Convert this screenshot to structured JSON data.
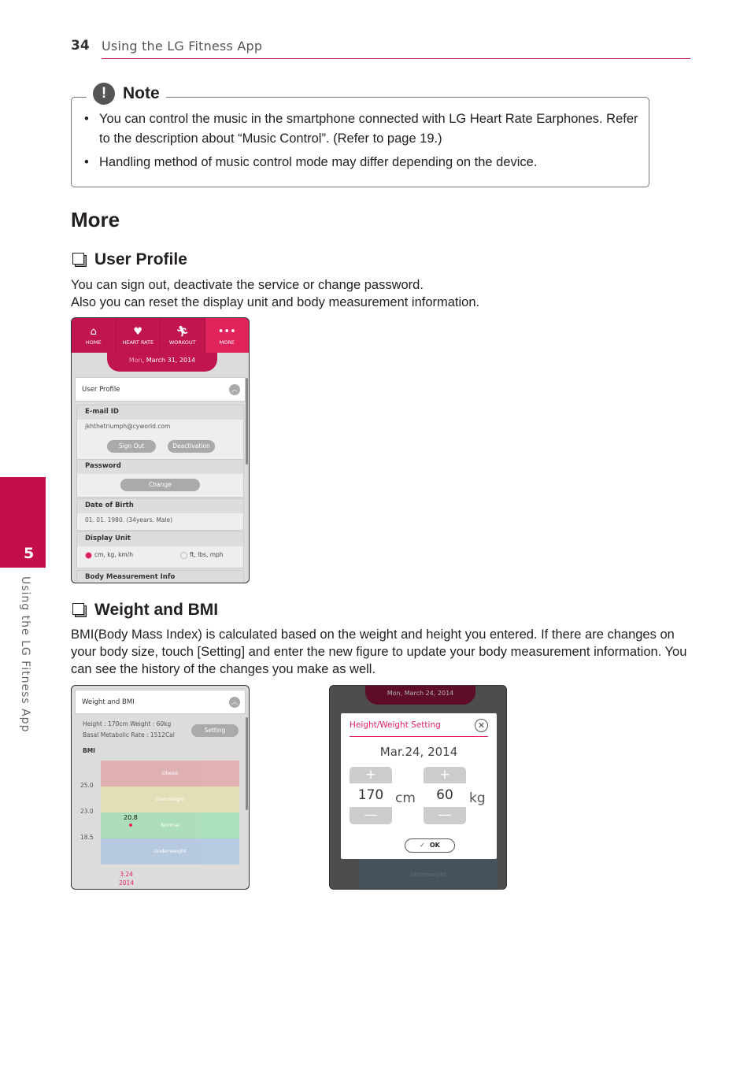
{
  "header": {
    "page_number": "34",
    "running_title": "Using the LG Fitness App"
  },
  "side_tab": {
    "chapter": "5",
    "label": "Using the LG Fitness App"
  },
  "note": {
    "title": "Note",
    "icon": "exclamation-icon",
    "items": [
      "You can control the music in the smartphone connected with LG Heart Rate Earphones. Refer to the description about “Music Control”. (Refer to page 19.)",
      "Handling method of music control mode may differ depending on the device."
    ]
  },
  "section": {
    "title": "More",
    "user_profile": {
      "heading": "User Profile",
      "paragraph_lines": [
        "You can sign out, deactivate the service or change password.",
        "Also you can reset the display unit and body measurement information."
      ]
    },
    "weight_bmi": {
      "heading": "Weight and BMI",
      "paragraph": "BMI(Body Mass Index) is calculated based on the weight and height you entered. If there are changes on your body size, touch [Setting] and enter the new figure to update your body measurement information. You can see the history of the changes you make as well."
    }
  },
  "screen1": {
    "nav": [
      {
        "label": "HOME",
        "icon": "home-icon",
        "glyph": "⌂"
      },
      {
        "label": "HEART RATE",
        "icon": "heart-rate-icon",
        "glyph": "♥"
      },
      {
        "label": "WORKOUT",
        "icon": "running-icon",
        "glyph": "🏃︎"
      },
      {
        "label": "MORE",
        "icon": "more-dots-icon",
        "glyph": "•••"
      }
    ],
    "date_dow": "Mon",
    "date_rest": ", March 31, 2014",
    "card_title": "User Profile",
    "email_label": "E-mail ID",
    "email_value": "jkhthetriumph@cyworld.com",
    "sign_out": "Sign Out",
    "deactivation": "Deactivation",
    "password_label": "Password",
    "change": "Change",
    "dob_label": "Date of Birth",
    "dob_value": "01. 01. 1980. (34years. Male)",
    "unit_label": "Display Unit",
    "unit_metric": "cm, kg, km/h",
    "unit_imperial": "ft, lbs, mph",
    "unit_selected": "cm, kg, km/h",
    "body_label": "Body Measurement Info"
  },
  "screen2": {
    "card_title": "Weight and BMI",
    "height_weight": "Height : 170cm   Weight : 60kg",
    "bmr": "Basal Metabolic Rate : 1512Cal",
    "setting": "Setting",
    "bmi_label": "BMI"
  },
  "chart_data": {
    "type": "scatter",
    "title": "BMI",
    "bands": [
      {
        "name": "Obese",
        "from": 25.0,
        "to": null,
        "color": "#e0aeb0"
      },
      {
        "name": "Overweight",
        "from": 23.0,
        "to": 25.0,
        "color": "#e3e0b5"
      },
      {
        "name": "Normal",
        "from": 18.5,
        "to": 23.0,
        "color": "#a9dfb8"
      },
      {
        "name": "Underweight",
        "from": null,
        "to": 18.5,
        "color": "#b4c9df"
      }
    ],
    "y_ticks": [
      "25.0",
      "23.0",
      "18.5"
    ],
    "points": [
      {
        "x_label_line1": "3.24",
        "x_label_line2": "2014",
        "y": 20.8,
        "label": "20.8"
      }
    ]
  },
  "screen3": {
    "date_dow": "Mon",
    "date_rest": ", March 24, 2014",
    "modal_title": "Height/Weight Setting",
    "modal_date": "Mar.24, 2014",
    "height_value": "170",
    "height_unit": "cm",
    "weight_value": "60",
    "weight_unit": "kg",
    "ok": "OK",
    "bg_band_label": "Underweight"
  }
}
